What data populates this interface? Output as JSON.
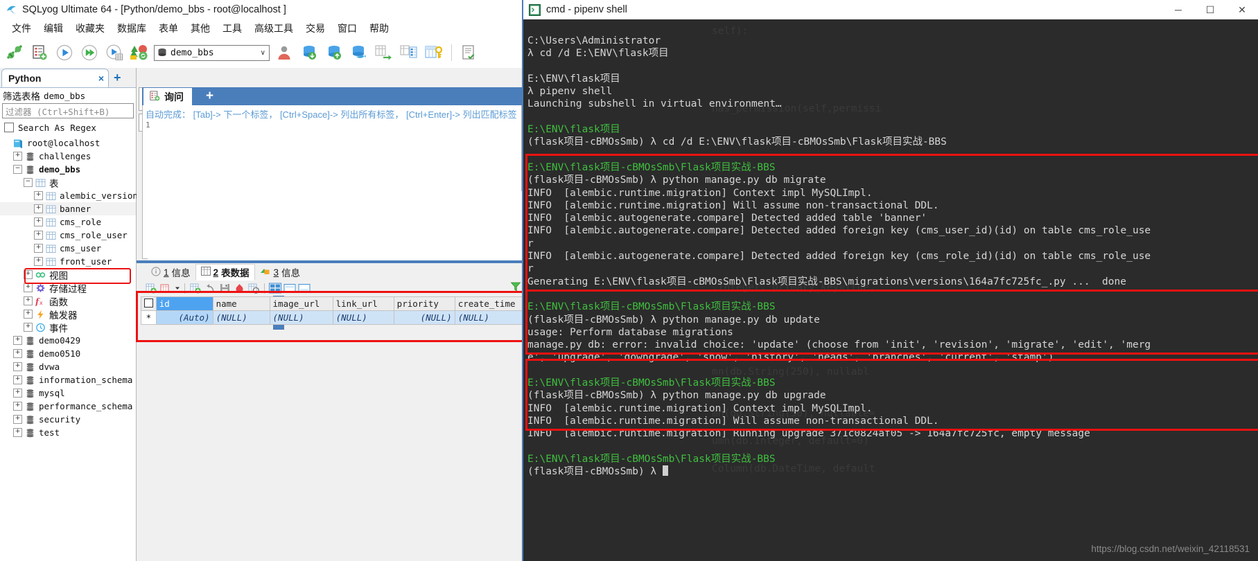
{
  "sqlyog": {
    "title": "SQLyog Ultimate 64 - [Python/demo_bbs - root@localhost ]",
    "menu": [
      "文件",
      "编辑",
      "收藏夹",
      "数据库",
      "表单",
      "其他",
      "工具",
      "高级工具",
      "交易",
      "窗口",
      "帮助"
    ],
    "toolbar": {
      "database_value": "demo_bbs",
      "caret": "∨"
    },
    "object_browser": {
      "tab_label": "Python",
      "tab_close": "×",
      "tab_add": "+",
      "filter_label": "筛选表格",
      "filter_db": "demo_bbs",
      "filter_placeholder": "过滤器 (Ctrl+Shift+B)",
      "regex_label": "Search As Regex",
      "tree": [
        {
          "label": "root@localhost",
          "indent": 0,
          "expander": "",
          "icon": "server-icon",
          "bold": false,
          "zh": false
        },
        {
          "label": "challenges",
          "indent": 1,
          "expander": "+",
          "icon": "db-icon",
          "bold": false,
          "zh": false
        },
        {
          "label": "demo_bbs",
          "indent": 1,
          "expander": "−",
          "icon": "db-icon",
          "bold": true,
          "zh": false
        },
        {
          "label": "表",
          "indent": 2,
          "expander": "−",
          "icon": "table-group-icon",
          "bold": false,
          "zh": true
        },
        {
          "label": "alembic_version",
          "indent": 3,
          "expander": "+",
          "icon": "table-icon",
          "bold": false,
          "zh": false
        },
        {
          "label": "banner",
          "indent": 3,
          "expander": "+",
          "icon": "table-icon",
          "bold": false,
          "zh": false,
          "highlight": true
        },
        {
          "label": "cms_role",
          "indent": 3,
          "expander": "+",
          "icon": "table-icon",
          "bold": false,
          "zh": false
        },
        {
          "label": "cms_role_user",
          "indent": 3,
          "expander": "+",
          "icon": "table-icon",
          "bold": false,
          "zh": false
        },
        {
          "label": "cms_user",
          "indent": 3,
          "expander": "+",
          "icon": "table-icon",
          "bold": false,
          "zh": false
        },
        {
          "label": "front_user",
          "indent": 3,
          "expander": "+",
          "icon": "table-icon",
          "bold": false,
          "zh": false
        },
        {
          "label": "视图",
          "indent": 2,
          "expander": "+",
          "icon": "view-icon",
          "bold": false,
          "zh": true
        },
        {
          "label": "存储过程",
          "indent": 2,
          "expander": "+",
          "icon": "procedure-icon",
          "bold": false,
          "zh": true
        },
        {
          "label": "函数",
          "indent": 2,
          "expander": "+",
          "icon": "function-icon",
          "bold": false,
          "zh": true
        },
        {
          "label": "触发器",
          "indent": 2,
          "expander": "+",
          "icon": "trigger-icon",
          "bold": false,
          "zh": true
        },
        {
          "label": "事件",
          "indent": 2,
          "expander": "+",
          "icon": "event-icon",
          "bold": false,
          "zh": true
        },
        {
          "label": "demo0429",
          "indent": 1,
          "expander": "+",
          "icon": "db-icon",
          "bold": false,
          "zh": false
        },
        {
          "label": "demo0510",
          "indent": 1,
          "expander": "+",
          "icon": "db-icon",
          "bold": false,
          "zh": false
        },
        {
          "label": "dvwa",
          "indent": 1,
          "expander": "+",
          "icon": "db-icon",
          "bold": false,
          "zh": false
        },
        {
          "label": "information_schema",
          "indent": 1,
          "expander": "+",
          "icon": "db-icon",
          "bold": false,
          "zh": false
        },
        {
          "label": "mysql",
          "indent": 1,
          "expander": "+",
          "icon": "db-icon",
          "bold": false,
          "zh": false
        },
        {
          "label": "performance_schema",
          "indent": 1,
          "expander": "+",
          "icon": "db-icon",
          "bold": false,
          "zh": false
        },
        {
          "label": "security",
          "indent": 1,
          "expander": "+",
          "icon": "db-icon",
          "bold": false,
          "zh": false
        },
        {
          "label": "test",
          "indent": 1,
          "expander": "+",
          "icon": "db-icon",
          "bold": false,
          "zh": false
        }
      ]
    },
    "query_editor": {
      "tab_label": "询问",
      "tab_add": "+",
      "hint": "自动完成： [Tab]-> 下一个标签， [Ctrl+Space]-> 列出所有标签， [Ctrl+Enter]-> 列出匹配标签",
      "line_number": "1"
    },
    "result_tabs": [
      {
        "num": "1",
        "label": "信息",
        "icon": "info-icon",
        "active": false
      },
      {
        "num": "2",
        "label": "表数据",
        "icon": "table-icon",
        "active": true
      },
      {
        "num": "3",
        "label": "信息",
        "icon": "objects-icon",
        "active": false
      }
    ],
    "grid": {
      "columns": [
        "id",
        "name",
        "image_url",
        "link_url",
        "priority",
        "create_time"
      ],
      "rows": [
        {
          "marker": "*",
          "cells": [
            "(Auto)",
            "(NULL)",
            "(NULL)",
            "(NULL)",
            "(NULL)",
            "(NULL)"
          ]
        }
      ]
    }
  },
  "cmd": {
    "title": "cmd - pipenv shell",
    "window_buttons": {
      "minimize": "─",
      "maximize": "☐",
      "close": "✕"
    },
    "lines": [
      {
        "t": "w",
        "s": "C:\\Users\\Administrator"
      },
      {
        "t": "w",
        "s": "λ cd /d E:\\ENV\\flask项目"
      },
      {
        "t": "blank",
        "s": " "
      },
      {
        "t": "w",
        "s": "E:\\ENV\\flask项目"
      },
      {
        "t": "w",
        "s": "λ pipenv shell"
      },
      {
        "t": "w",
        "s": "Launching subshell in virtual environment…"
      },
      {
        "t": "blank",
        "s": " "
      },
      {
        "t": "g",
        "s": "E:\\ENV\\flask项目"
      },
      {
        "t": "w",
        "s": "(flask项目-cBMOsSmb) λ cd /d E:\\ENV\\flask项目-cBMOsSmb\\Flask项目实战-BBS"
      },
      {
        "t": "blank",
        "s": " "
      },
      {
        "t": "g",
        "s": "E:\\ENV\\flask项目-cBMOsSmb\\Flask项目实战-BBS"
      },
      {
        "t": "w",
        "s": "(flask项目-cBMOsSmb) λ python manage.py db migrate"
      },
      {
        "t": "w",
        "s": "INFO  [alembic.runtime.migration] Context impl MySQLImpl."
      },
      {
        "t": "w",
        "s": "INFO  [alembic.runtime.migration] Will assume non-transactional DDL."
      },
      {
        "t": "w",
        "s": "INFO  [alembic.autogenerate.compare] Detected added table 'banner'"
      },
      {
        "t": "w",
        "s": "INFO  [alembic.autogenerate.compare] Detected added foreign key (cms_user_id)(id) on table cms_role_use"
      },
      {
        "t": "w",
        "s": "r"
      },
      {
        "t": "w",
        "s": "INFO  [alembic.autogenerate.compare] Detected added foreign key (cms_role_id)(id) on table cms_role_use"
      },
      {
        "t": "w",
        "s": "r"
      },
      {
        "t": "w",
        "s": "Generating E:\\ENV\\flask项目-cBMOsSmb\\Flask项目实战-BBS\\migrations\\versions\\164a7fc725fc_.py ...  done"
      },
      {
        "t": "blank",
        "s": " "
      },
      {
        "t": "g",
        "s": "E:\\ENV\\flask项目-cBMOsSmb\\Flask项目实战-BBS"
      },
      {
        "t": "w",
        "s": "(flask项目-cBMOsSmb) λ python manage.py db update"
      },
      {
        "t": "w",
        "s": "usage: Perform database migrations"
      },
      {
        "t": "w",
        "s": "manage.py db: error: invalid choice: 'update' (choose from 'init', 'revision', 'migrate', 'edit', 'merg"
      },
      {
        "t": "w",
        "s": "e', 'upgrade', 'downgrade', 'show', 'history', 'heads', 'branches', 'current', 'stamp')"
      },
      {
        "t": "blank",
        "s": " "
      },
      {
        "t": "g",
        "s": "E:\\ENV\\flask项目-cBMOsSmb\\Flask项目实战-BBS"
      },
      {
        "t": "w",
        "s": "(flask项目-cBMOsSmb) λ python manage.py db upgrade"
      },
      {
        "t": "w",
        "s": "INFO  [alembic.runtime.migration] Context impl MySQLImpl."
      },
      {
        "t": "w",
        "s": "INFO  [alembic.runtime.migration] Will assume non-transactional DDL."
      },
      {
        "t": "w",
        "s": "INFO  [alembic.runtime.migration] Running upgrade 371c0824af05 -> 164a7fc725fc, empty message"
      },
      {
        "t": "blank",
        "s": " "
      },
      {
        "t": "g",
        "s": "E:\\ENV\\flask项目-cBMOsSmb\\Flask项目实战-BBS"
      },
      {
        "t": "prompt",
        "s": "(flask项目-cBMOsSmb) λ "
      }
    ]
  },
  "watermark": "https://blog.csdn.net/weixin_42118531",
  "colors": {
    "accent_blue": "#4a7ebb",
    "highlight_red": "#ee1111",
    "terminal_bg": "#2b2b2b",
    "prompt_green": "#3fbf3f",
    "grid_selected": "#4ea3f0"
  }
}
